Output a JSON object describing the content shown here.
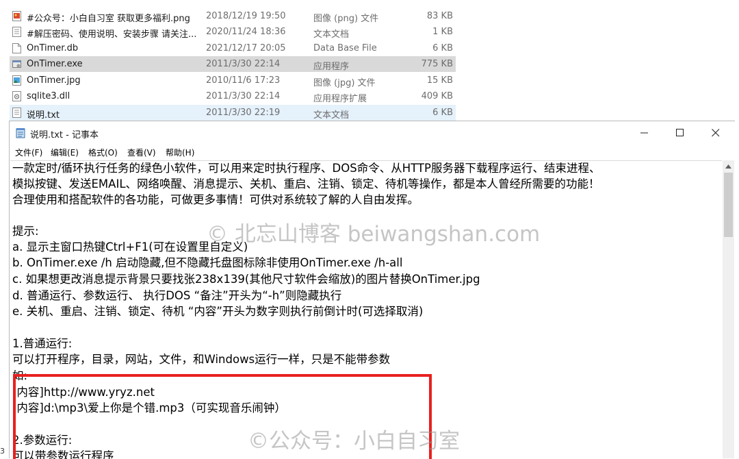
{
  "explorer": {
    "files": [
      {
        "name": "#公众号：小白自习室 获取更多福利.png",
        "date": "2018/12/19 19:50",
        "type": "图像 (png) 文件",
        "size": "83 KB",
        "icon": "png-image-icon",
        "state": "normal"
      },
      {
        "name": "#解压密码、使用说明、安装步骤 请关注...",
        "date": "2020/11/24 18:36",
        "type": "文本文档",
        "size": "1 KB",
        "icon": "text-document-icon",
        "state": "normal"
      },
      {
        "name": "OnTimer.db",
        "date": "2021/12/17 20:05",
        "type": "Data Base File",
        "size": "6 KB",
        "icon": "generic-file-icon",
        "state": "normal"
      },
      {
        "name": "OnTimer.exe",
        "date": "2011/3/30 22:14",
        "type": "应用程序",
        "size": "775 KB",
        "icon": "application-icon",
        "state": "selected"
      },
      {
        "name": "OnTimer.jpg",
        "date": "2010/11/6 17:23",
        "type": "图像 (jpg) 文件",
        "size": "15 KB",
        "icon": "jpg-image-icon",
        "state": "normal"
      },
      {
        "name": "sqlite3.dll",
        "date": "2011/3/30 22:14",
        "type": "应用程序扩展",
        "size": "409 KB",
        "icon": "dll-file-icon",
        "state": "normal"
      },
      {
        "name": "说明.txt",
        "date": "2011/3/30 22:19",
        "type": "文本文档",
        "size": "6 KB",
        "icon": "text-document-icon",
        "state": "hover"
      }
    ]
  },
  "notepad": {
    "title": "说明.txt - 记事本",
    "menu": [
      "文件(F)",
      "编辑(E)",
      "格式(O)",
      "查看(V)",
      "帮助(H)"
    ],
    "lines": [
      "      一款定时/循环执行任务的绿色小软件，可以用来定时执行程序、DOS命令、从HTTP服务器下载程序运行、结束进程、",
      "模拟按键、发送EMAIL、网络唤醒、消息提示、关机、重启、注销、锁定、待机等操作，都是本人曾经所需要的功能！",
      "      合理使用和搭配软件的各功能，可做更多事情！可供对系统较了解的人自由发挥。",
      "",
      "提示:",
      "  a. 显示主窗口热键Ctrl+F1(可在设置里自定义)",
      "  b. OnTimer.exe /h 启动隐藏,但不隐藏托盘图标除非使用OnTimer.exe /h-all",
      "  c. 如果想更改消息提示背景只要找张238x139(其他尺寸软件会缩放)的图片替换OnTimer.jpg",
      "  d. 普通运行、参数运行、 执行DOS “备注”开头为“-h”则隐藏执行",
      "  e. 关机、重启、注销、锁定、待机 “内容”开头为数字则执行前倒计时(可选择取消)",
      "",
      "1.普通运行:",
      "    可以打开程序，目录，网站，文件，和Windows运行一样，只是不能带参数",
      "  如:",
      "  [内容]http://www.yryz.net",
      "  [内容]d:\\mp3\\爱上你是个错.mp3（可实现音乐闹钟）",
      "",
      "2.参数运行:",
      "    可以带参数运行程序"
    ]
  },
  "watermarks": {
    "blog": "© 北忘山博客 beiwangshan.com",
    "account": "©公众号：小白自习室"
  },
  "edge_char": "3",
  "colors": {
    "highlight_box": "#e8201e",
    "selected_row": "#d9d9d9",
    "hover_row": "#e5f1fb"
  }
}
